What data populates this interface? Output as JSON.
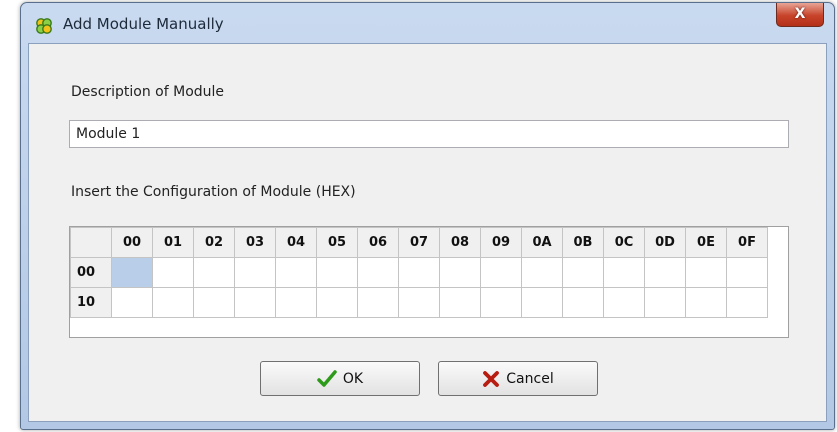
{
  "window": {
    "title": "Add Module Manually",
    "close_label": "X"
  },
  "description": {
    "label": "Description of Module",
    "value": "Module 1"
  },
  "configuration": {
    "label": "Insert the Configuration of Module (HEX)",
    "columns": [
      "00",
      "01",
      "02",
      "03",
      "04",
      "05",
      "06",
      "07",
      "08",
      "09",
      "0A",
      "0B",
      "0C",
      "0D",
      "0E",
      "0F"
    ],
    "rows": [
      "00",
      "10"
    ],
    "selected_cell": {
      "row": "00",
      "column": "00"
    }
  },
  "buttons": {
    "ok": "OK",
    "cancel": "Cancel"
  },
  "icons": {
    "app": "app-icon",
    "ok": "check-icon",
    "cancel": "cross-icon"
  },
  "colors": {
    "selected_cell": "#b9cfe9",
    "close_button": "#c7432a",
    "check": "#2e9a1a",
    "cross": "#b81d12"
  }
}
